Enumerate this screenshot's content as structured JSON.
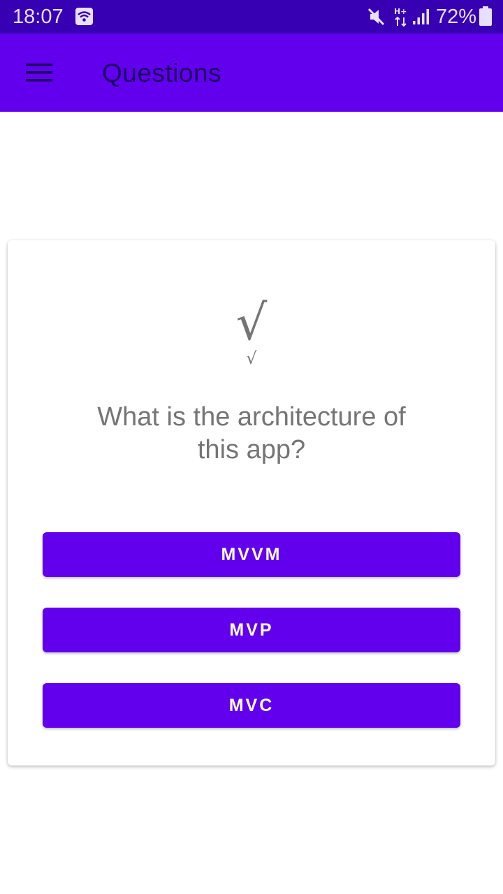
{
  "status_bar": {
    "time": "18:07",
    "battery_percent": "72%",
    "icons": [
      "wifi-icon",
      "mute-icon",
      "network-hplus-icon",
      "signal-icon",
      "battery-icon"
    ]
  },
  "app_bar": {
    "title": "Questions",
    "menu_icon": "menu-icon"
  },
  "question_card": {
    "check_large": "√",
    "check_small": "√",
    "question": "What is the architecture of this app?",
    "answers": [
      {
        "label": "MVVM"
      },
      {
        "label": "MVP"
      },
      {
        "label": "MVC"
      }
    ]
  },
  "colors": {
    "status_bar": "#3700b3",
    "primary": "#6200ee",
    "title_text": "#1b0060",
    "muted_text": "#757575"
  }
}
